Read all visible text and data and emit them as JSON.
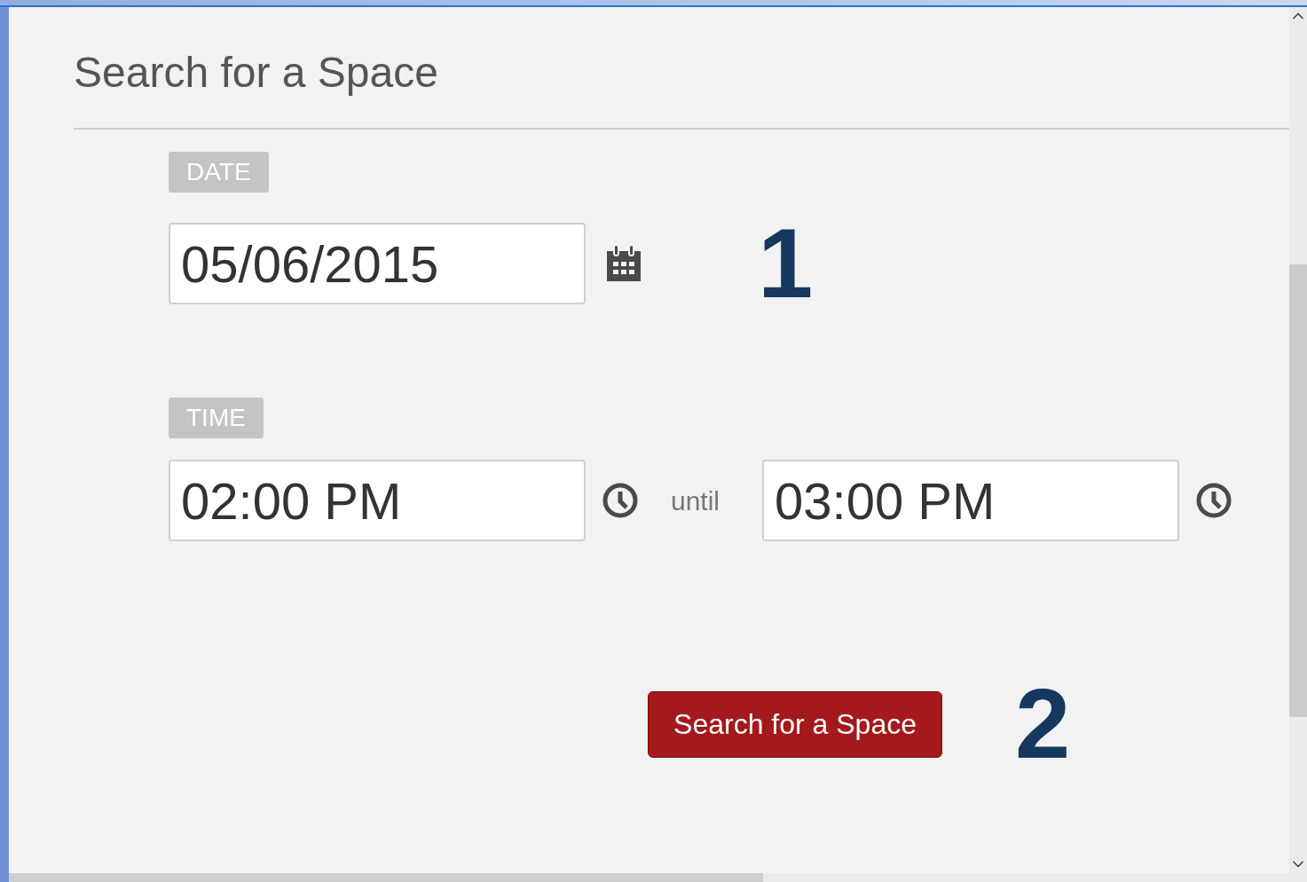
{
  "heading": "Search for a Space",
  "date": {
    "label": "DATE",
    "value": "05/06/2015"
  },
  "time": {
    "label": "TIME",
    "start": "02:00 PM",
    "separator": "until",
    "end": "03:00 PM"
  },
  "search_button": "Search for a Space",
  "step_markers": [
    "1",
    "2"
  ]
}
